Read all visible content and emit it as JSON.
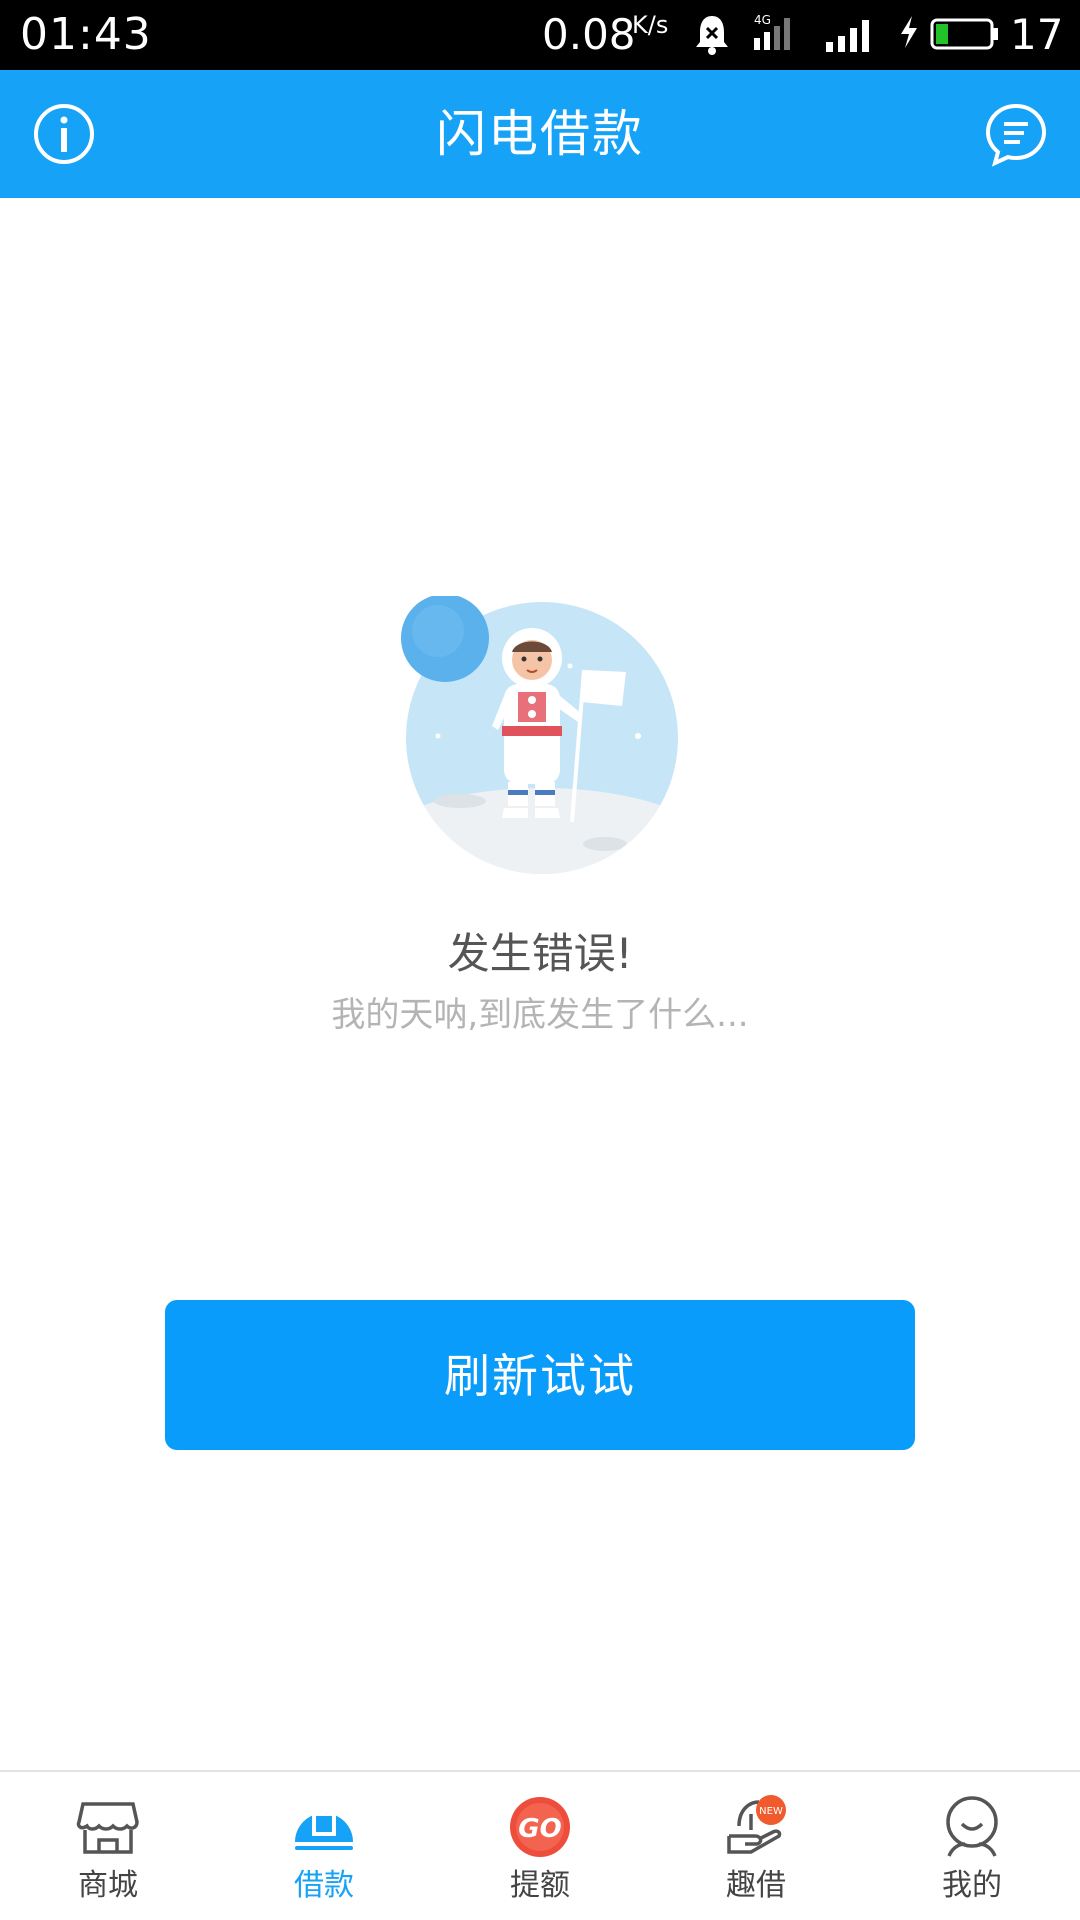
{
  "status_bar": {
    "time": "01:43",
    "net_speed": "0.08",
    "net_speed_unit": "K/s",
    "network_type": "4G",
    "battery_level": "17"
  },
  "header": {
    "title": "闪电借款",
    "left_icon": "info-icon",
    "right_icon": "message-icon"
  },
  "error": {
    "title": "发生错误!",
    "subtitle": "我的天呐,到底发生了什么...",
    "illustration": "astronaut-on-moon"
  },
  "actions": {
    "refresh_label": "刷新试试"
  },
  "bottom_nav": {
    "items": [
      {
        "label": "商城",
        "icon": "store-icon",
        "active": false
      },
      {
        "label": "借款",
        "icon": "loan-icon",
        "active": true
      },
      {
        "label": "提额",
        "icon": "go-icon",
        "active": false
      },
      {
        "label": "趣借",
        "icon": "fun-loan-icon",
        "active": false,
        "badge": "NEW"
      },
      {
        "label": "我的",
        "icon": "profile-icon",
        "active": false
      }
    ]
  },
  "colors": {
    "primary": "#16a2f6",
    "button": "#0a9cfa",
    "go_red": "#ef4d3b",
    "badge": "#f05a2c"
  }
}
